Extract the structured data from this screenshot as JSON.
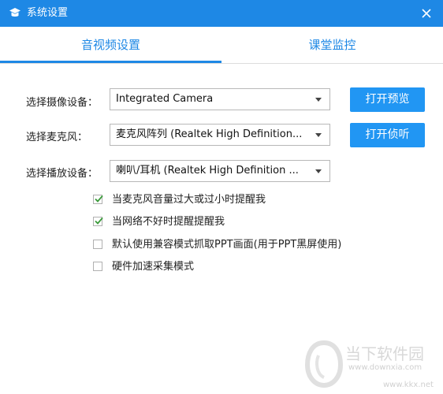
{
  "window": {
    "title": "系统设置",
    "accent": "#1e88e5",
    "button_color": "#2196f3"
  },
  "tabs": [
    {
      "label": "音视频设置",
      "active": true
    },
    {
      "label": "课堂监控",
      "active": false
    }
  ],
  "settings": {
    "camera": {
      "label": "选择摄像设备：",
      "value": "Integrated Camera",
      "button": "打开预览"
    },
    "microphone": {
      "label": "选择麦克风：",
      "value": "麦克风阵列 (Realtek High Definition...",
      "button": "打开侦听"
    },
    "speaker": {
      "label": "选择播放设备：",
      "value": "喇叭/耳机 (Realtek High Definition ..."
    }
  },
  "options": [
    {
      "label": "当麦克风音量过大或过小时提醒我",
      "checked": true
    },
    {
      "label": "当网络不好时提醒提醒我",
      "checked": true
    },
    {
      "label": "默认使用兼容模式抓取PPT画面(用于PPT黑屏使用)",
      "checked": false
    },
    {
      "label": "硬件加速采集模式",
      "checked": false
    }
  ],
  "watermark": {
    "name": "当下软件园",
    "url1": "www.downxia.com",
    "url2": "www.kkx.net"
  },
  "icons": {
    "app": "app-logo-icon",
    "close": "close-icon",
    "dropdown": "chevron-down-icon",
    "check": "checkmark-icon"
  }
}
